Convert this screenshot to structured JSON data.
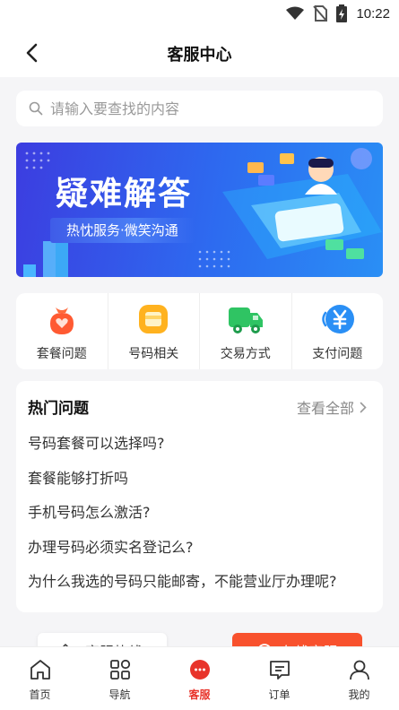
{
  "status_bar": {
    "time": "10:22"
  },
  "header": {
    "title": "客服中心"
  },
  "search": {
    "placeholder": "请输入要查找的内容"
  },
  "banner": {
    "title": "疑难解答",
    "subtitle": "热忱服务·微笑沟通"
  },
  "quick_links": [
    {
      "label": "套餐问题",
      "icon": "gift-bag-icon"
    },
    {
      "label": "号码相关",
      "icon": "sim-card-icon"
    },
    {
      "label": "交易方式",
      "icon": "delivery-truck-icon"
    },
    {
      "label": "支付问题",
      "icon": "yen-coin-icon"
    }
  ],
  "faq": {
    "title": "热门问题",
    "more_label": "查看全部",
    "items": [
      "号码套餐可以选择吗?",
      "套餐能够打折吗",
      "手机号码怎么激活?",
      "办理号码必须实名登记么?",
      "为什么我选的号码只能邮寄，不能营业厅办理呢?"
    ]
  },
  "float_buttons": {
    "hotline": "客服热线",
    "online": "在线客服"
  },
  "tabs": [
    {
      "label": "首页",
      "icon": "home-icon"
    },
    {
      "label": "导航",
      "icon": "grid-icon"
    },
    {
      "label": "客服",
      "icon": "chat-bubble-icon",
      "active": true
    },
    {
      "label": "订单",
      "icon": "order-icon"
    },
    {
      "label": "我的",
      "icon": "user-icon"
    }
  ],
  "colors": {
    "accent": "#f8512d",
    "active_tab": "#e8342b",
    "banner_start": "#3c3de0",
    "banner_end": "#2a8ff5"
  }
}
